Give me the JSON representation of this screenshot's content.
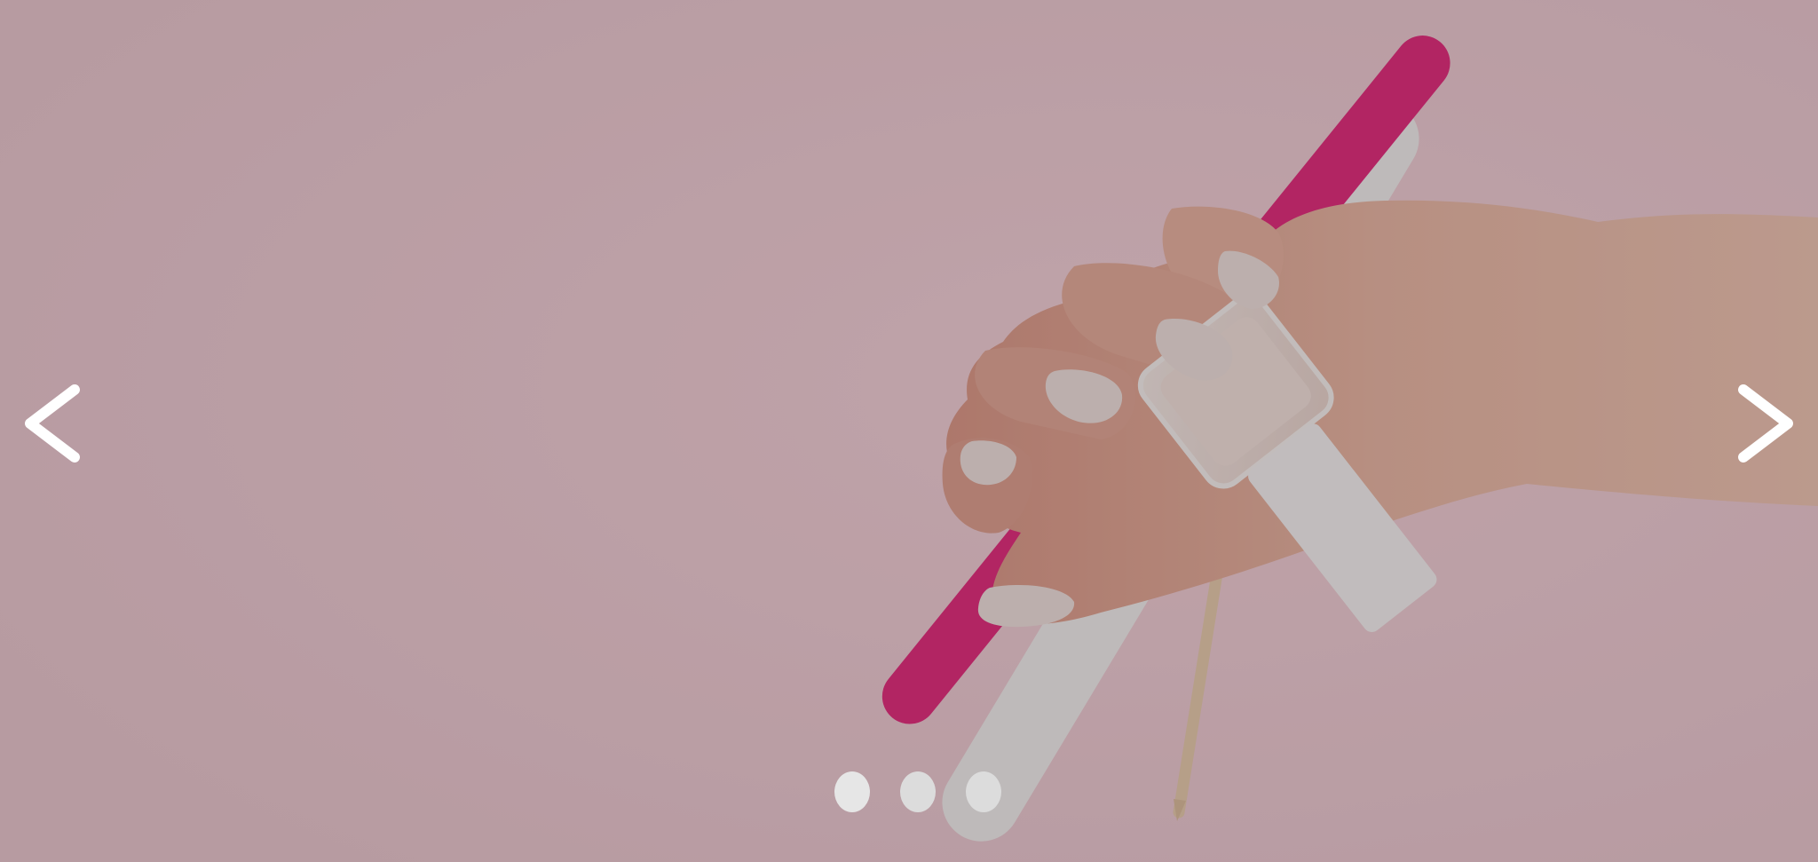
{
  "carousel": {
    "slide": {
      "image_icon": "hand-holding-nail-polish-and-files-illustration"
    },
    "prev_icon": "chevron-left-icon",
    "next_icon": "chevron-right-icon",
    "indicators": [
      {
        "active": true
      },
      {
        "active": false
      },
      {
        "active": false
      }
    ],
    "colors": {
      "background": "#c9a9b1",
      "file_pink": "#e0156f",
      "file_white": "#e9e7e6",
      "skin": "#e2ad96",
      "nail_polish": "#efe1dc",
      "dot": "#dcdcdc",
      "arrow": "#ffffff"
    }
  }
}
